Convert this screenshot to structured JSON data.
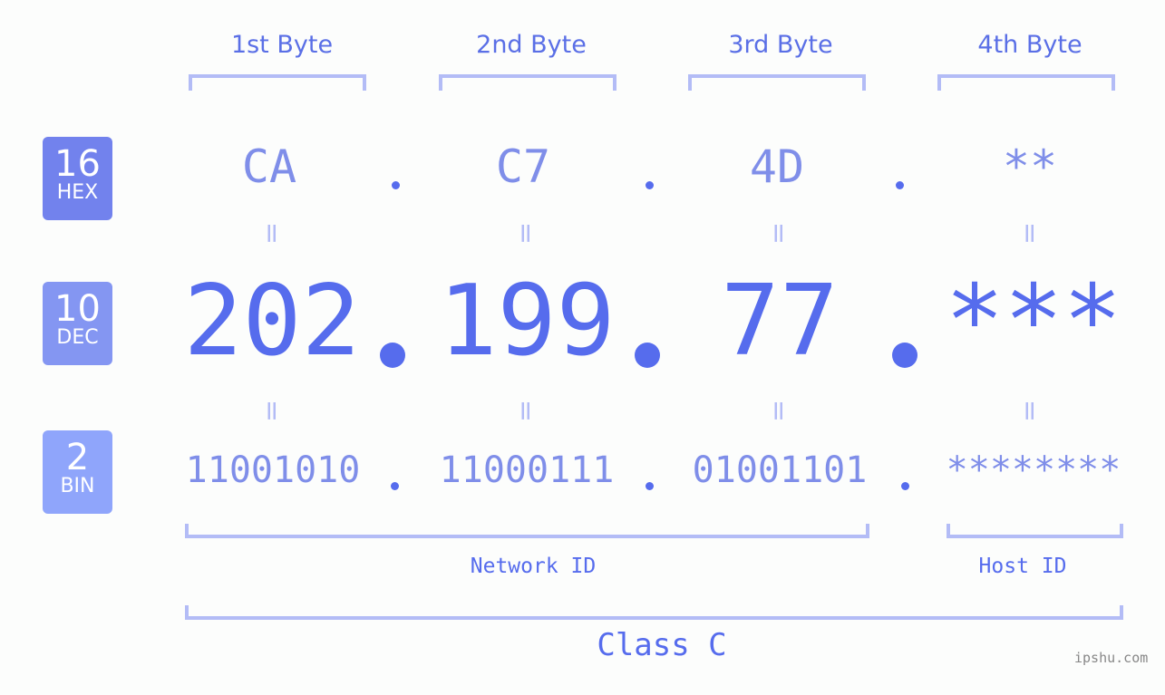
{
  "bytes": [
    {
      "label": "1st Byte",
      "hex": "CA",
      "dec": "202",
      "bin": "11001010"
    },
    {
      "label": "2nd Byte",
      "hex": "C7",
      "dec": "199",
      "bin": "11000111"
    },
    {
      "label": "3rd Byte",
      "hex": "4D",
      "dec": "77",
      "bin": "01001101"
    },
    {
      "label": "4th Byte",
      "hex": "**",
      "dec": "***",
      "bin": "********"
    }
  ],
  "bases": {
    "hex": {
      "number": "16",
      "name": "HEX",
      "color": "#7282ed"
    },
    "dec": {
      "number": "10",
      "name": "DEC",
      "color": "#8496f2"
    },
    "bin": {
      "number": "2",
      "name": "BIN",
      "color": "#8fa5fb"
    }
  },
  "equals_symbol": "=",
  "separator": ".",
  "network_id_label": "Network ID",
  "host_id_label": "Host ID",
  "class_label": "Class C",
  "watermark": "ipshu.com",
  "colors": {
    "primary": "#566ced",
    "secondary": "#7f8ee9",
    "bracket": "#b3bcf6",
    "background": "#fcfdfc"
  }
}
